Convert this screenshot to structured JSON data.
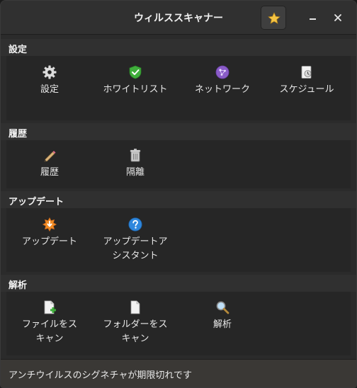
{
  "window": {
    "title": "ウィルススキャナー"
  },
  "titlebar": {
    "favorite_icon": "star-icon",
    "minimize_icon": "minimize-icon",
    "close_icon": "close-icon"
  },
  "sections": {
    "settings": {
      "header": "設定",
      "items": [
        {
          "label": "設定",
          "icon": "gear-icon"
        },
        {
          "label": "ホワイトリスト",
          "icon": "shield-check-icon"
        },
        {
          "label": "ネットワーク",
          "icon": "network-icon"
        },
        {
          "label": "スケジュール",
          "icon": "schedule-icon"
        }
      ]
    },
    "history": {
      "header": "履歴",
      "items": [
        {
          "label": "履歴",
          "icon": "pencil-icon"
        },
        {
          "label": "隔離",
          "icon": "quarantine-icon"
        }
      ]
    },
    "update": {
      "header": "アップデート",
      "items": [
        {
          "label": "アップデート",
          "icon": "update-star-icon"
        },
        {
          "label_line1": "アップデートア",
          "label_line2": "シスタント",
          "icon": "help-icon"
        }
      ]
    },
    "analysis": {
      "header": "解析",
      "items": [
        {
          "label_line1": "ファイルをス",
          "label_line2": "キャン",
          "icon": "file-add-icon"
        },
        {
          "label_line1": "フォルダーをス",
          "label_line2": "キャン",
          "icon": "document-icon"
        },
        {
          "label": "解析",
          "icon": "magnifier-icon"
        }
      ]
    }
  },
  "status": {
    "text": "アンチウイルスのシグネチャが期限切れです"
  },
  "colors": {
    "accent_gold": "#f5c443",
    "shield_green": "#3fae3b",
    "network_purple": "#8a5cc8",
    "update_orange": "#f08a24",
    "help_blue": "#2e87dd"
  }
}
